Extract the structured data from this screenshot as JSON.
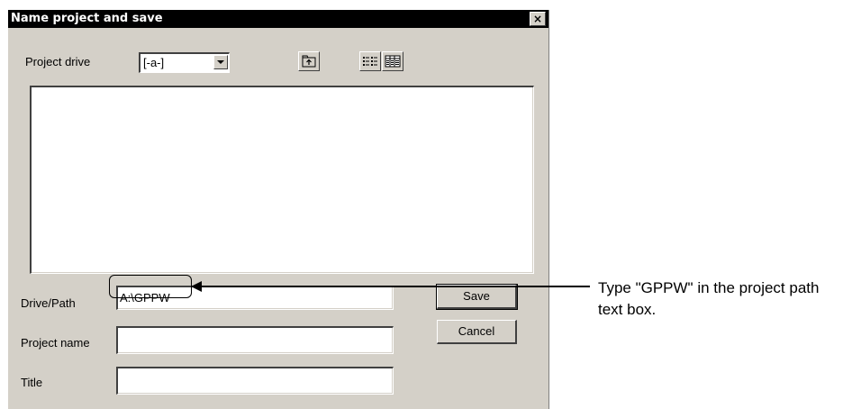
{
  "dialog": {
    "title": "Name project and save",
    "close_label": "×",
    "project_drive": {
      "label": "Project drive",
      "selected": "[-a-]"
    },
    "toolbar": {
      "up_folder_icon": "up-folder-icon",
      "list_view_icon": "list-view-icon",
      "details_view_icon": "details-view-icon"
    },
    "fields": {
      "drive_path_label": "Drive/Path",
      "drive_path_value": "A:\\GPPW",
      "project_name_label": "Project name",
      "project_name_value": "",
      "title_label": "Title",
      "title_value": ""
    },
    "buttons": {
      "save": "Save",
      "cancel": "Cancel"
    }
  },
  "annotation": {
    "text": "Type \"GPPW\" in the project path text box."
  }
}
